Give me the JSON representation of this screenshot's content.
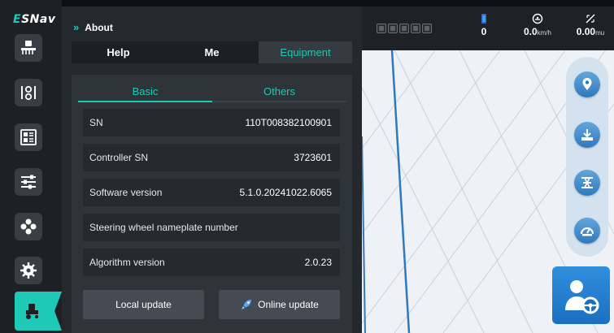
{
  "brand": {
    "prefix": "E",
    "rest": "SNav"
  },
  "rail": {
    "items": [
      {
        "icon": "implement-icon"
      },
      {
        "icon": "sensor-icon"
      },
      {
        "icon": "task-list-icon"
      },
      {
        "icon": "sliders-icon"
      },
      {
        "icon": "modules-icon"
      },
      {
        "icon": "settings-gear-icon"
      },
      {
        "icon": "tractor-info-icon",
        "active": true
      }
    ],
    "active_color": "#1ec9b6"
  },
  "panel": {
    "title": "About",
    "tabs": [
      {
        "label": "Help",
        "active": false
      },
      {
        "label": "Me",
        "active": false
      },
      {
        "label": "Equipment",
        "active": true
      }
    ],
    "subtabs": [
      {
        "label": "Basic",
        "active": true
      },
      {
        "label": "Others",
        "active": false
      }
    ],
    "rows": [
      {
        "label": "SN",
        "value": "110T008382100901"
      },
      {
        "label": "Controller SN",
        "value": "3723601"
      },
      {
        "label": "Software version",
        "value": "5.1.0.20241022.6065"
      },
      {
        "label": "Steering wheel nameplate number",
        "value": ""
      },
      {
        "label": "Algorithm version",
        "value": "2.0.23"
      }
    ],
    "buttons": {
      "local_update": "Local update",
      "online_update": "Online update"
    }
  },
  "status_bar": {
    "satellites": {
      "value": "0",
      "icon": "satellite-signal-icon"
    },
    "speed": {
      "value": "0.0",
      "unit": "km/h",
      "icon": "speedometer-icon"
    },
    "area": {
      "value": "0.00",
      "unit": "mu",
      "icon": "area-measure-icon"
    }
  },
  "map_tools": [
    "location-pin-icon",
    "download-field-icon",
    "path-split-icon",
    "gauge-icon"
  ],
  "driver_button_icon": "driver-steering-icon",
  "colors": {
    "accent": "#1ec9b6",
    "map_blue": "#3179bd",
    "panel_bg": "#25292e"
  }
}
